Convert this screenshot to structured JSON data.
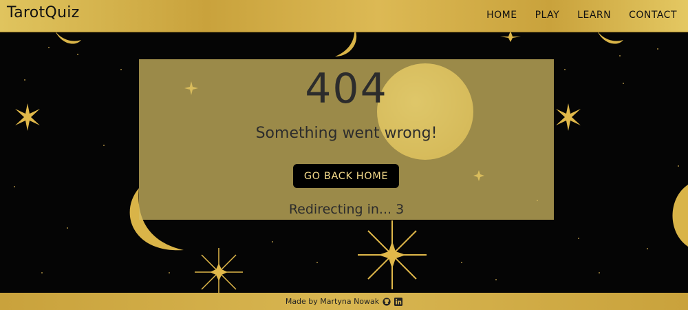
{
  "header": {
    "brand": "TarotQuiz",
    "nav": [
      "HOME",
      "PLAY",
      "LEARN",
      "CONTACT"
    ]
  },
  "error": {
    "code": "404",
    "message": "Something went wrong!",
    "button_label": "GO BACK HOME",
    "redirect_text": "Redirecting in... 3"
  },
  "footer": {
    "credit": "Made by Martyna Nowak",
    "icons": [
      "github-icon",
      "linkedin-icon"
    ]
  },
  "colors": {
    "gold": "#d4b24a",
    "panel": "#d6be64",
    "button_bg": "#000000",
    "button_text": "#f3d98a"
  }
}
